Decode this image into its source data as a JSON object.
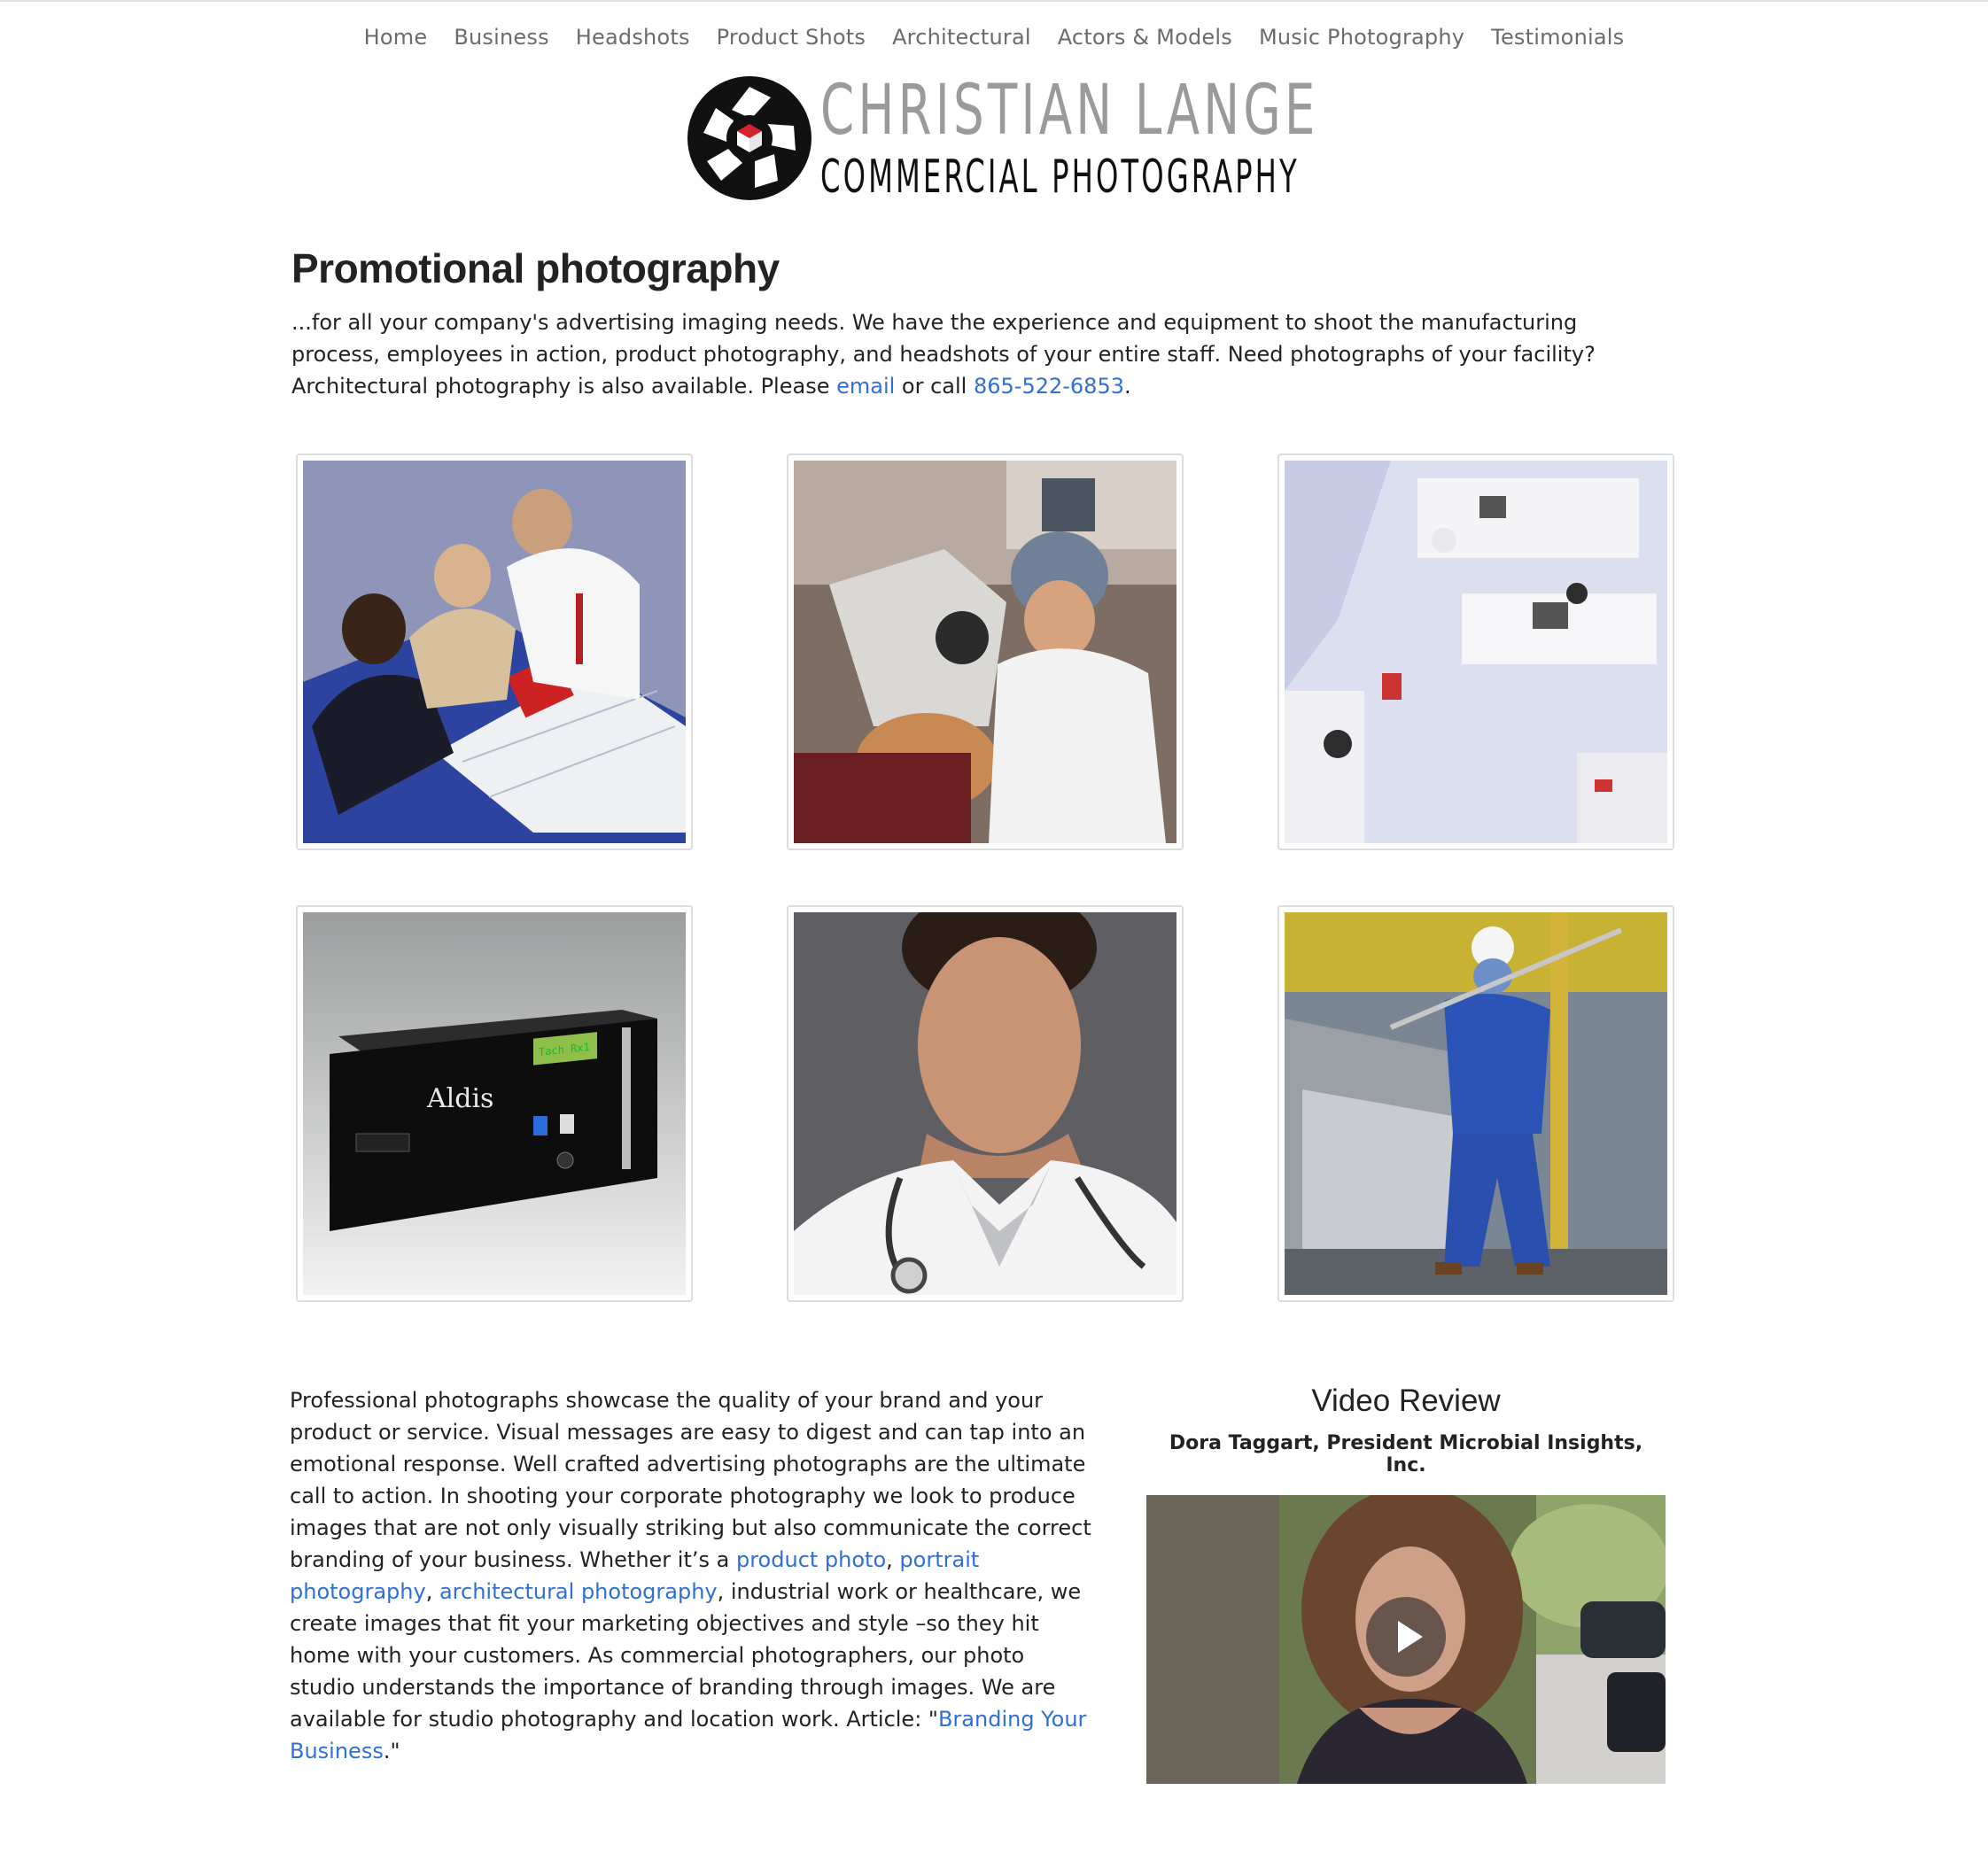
{
  "nav": {
    "items": [
      "Home",
      "Business",
      "Headshots",
      "Product Shots",
      "Architectural",
      "Actors & Models",
      "Music Photography",
      "Testimonials"
    ]
  },
  "logo": {
    "title": "CHRISTIAN LANGE",
    "subtitle": "COMMERCIAL PHOTOGRAPHY",
    "colors": {
      "aperture": "#111111",
      "accent": "#d4232a",
      "title": "#9a9a9a"
    }
  },
  "main": {
    "heading": "Promotional photography",
    "intro": {
      "text1": "...for all your company's advertising imaging needs. We have the experience and equipment to shoot the manufacturing process, employees in action, product photography, and headshots of your entire staff. Need photographs of your facility? Architectural photography is also available. Please ",
      "email_link": "email",
      "text2": " or call ",
      "phone_link": "865-522-6853",
      "text3": "."
    }
  },
  "gallery": {
    "images": [
      "business-meeting-photo",
      "eye-exam-photo",
      "laboratory-overhead-photo",
      "aldis-product-photo",
      "doctor-headshot-photo",
      "industrial-worker-photo"
    ],
    "product_brand": "Aldis",
    "product_display": "Tach Rx1"
  },
  "body": {
    "t1": "Professional photographs showcase the quality of your brand and your product or service. Visual messages are easy to digest and can tap into an emotional response. Well crafted advertising photographs are the ultimate call to action. In shooting your corporate photography we look to produce images that are not only visually striking but also communicate the correct branding of your business. Whether it’s a ",
    "link1": "product photo",
    "t2": ", ",
    "link2": "portrait photography",
    "t3": ", ",
    "link3": "architectural photography",
    "t4": ", industrial work or healthcare, we create images that fit your marketing objectives and style –so they hit home with your customers. As commercial photographers, our photo studio understands the importance of branding through images. We are available for studio photography and location work. Article: \"",
    "link4": "Branding Your Business",
    "t5": ".\""
  },
  "video_review": {
    "title": "Video Review",
    "subtitle": "Dora Taggart, President Microbial Insights, Inc."
  },
  "colors": {
    "link": "#2f6fd6",
    "nav": "#6b6b6b"
  }
}
